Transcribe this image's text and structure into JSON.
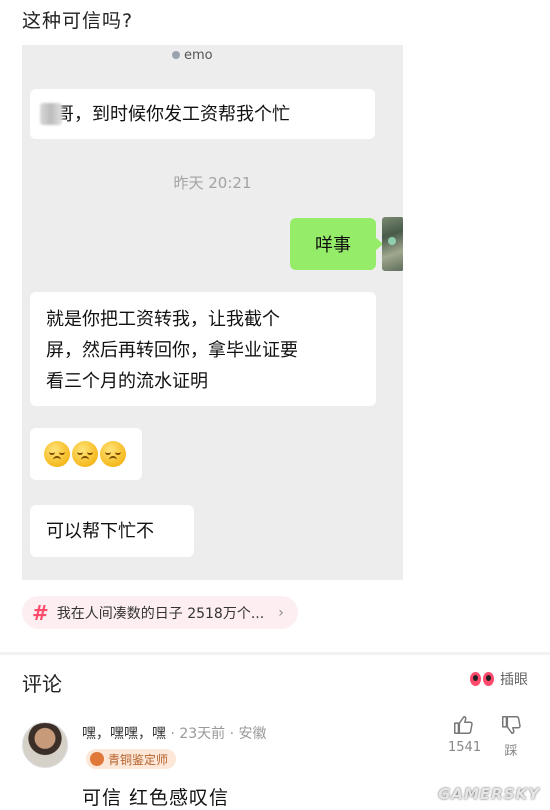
{
  "post": {
    "title": "这种可信吗?"
  },
  "chat": {
    "header_label": "emo",
    "messages": [
      {
        "from": "other",
        "text": "哥，到时候你发工资帮我个忙"
      },
      {
        "from": "me",
        "text": "咩事"
      },
      {
        "from": "other",
        "text": "就是你把工资转我，让我截个屏，然后再转回你，拿毕业证要看三个月的流水证明"
      },
      {
        "from": "other",
        "text": ""
      },
      {
        "from": "other",
        "text": "可以帮下忙不"
      }
    ],
    "timestamp": "昨天 20:21",
    "msg2_line1": "就是你把工资转我，让我截个",
    "msg2_line2": "屏，然后再转回你，拿毕业证要",
    "msg2_line3": "看三个月的流水证明"
  },
  "topic": {
    "text": "我在人间凑数的日子  2518万个...",
    "chevron": "›"
  },
  "comments": {
    "title": "评论",
    "chaiyan_label": "插眼",
    "items": [
      {
        "user": "嘿，嘿嘿，嘿",
        "meta": " · 23天前 · 安徽",
        "badge": "青铜鉴定师",
        "text": "可信   红色感叹信",
        "likes": "1541",
        "dislike_label": "踩"
      }
    ]
  },
  "watermark": "GAMERSKY"
}
